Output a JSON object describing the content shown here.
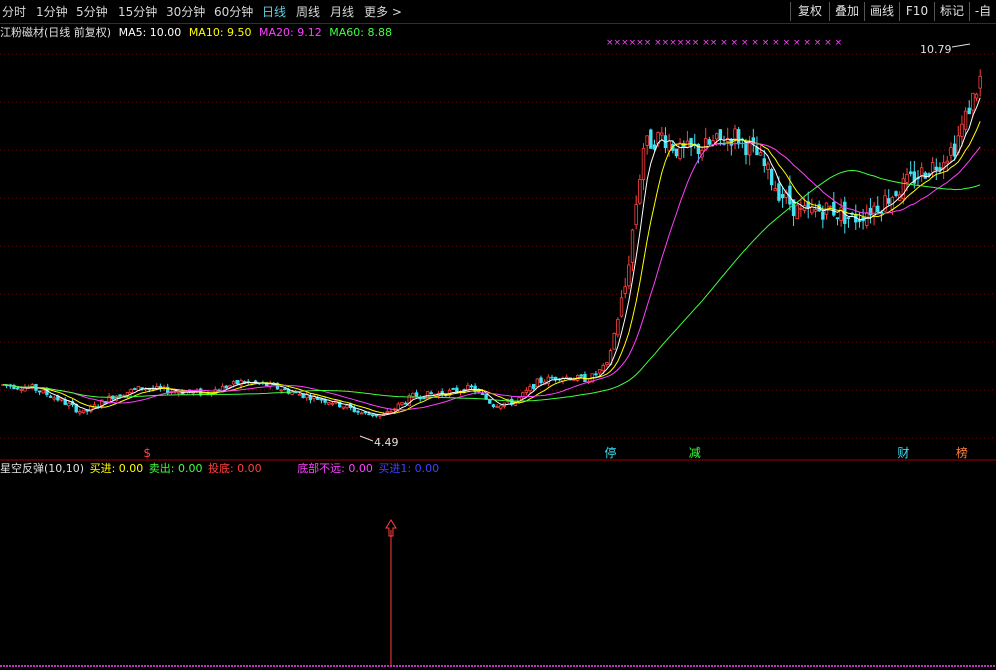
{
  "toolbar": {
    "periods": [
      "分时",
      "1分钟",
      "5分钟",
      "15分钟",
      "30分钟",
      "60分钟",
      "日线",
      "周线",
      "月线"
    ],
    "active_period": "日线",
    "more_label": "更多",
    "more_arrow": ">",
    "buttons": [
      "复权",
      "叠加",
      "画线",
      "F10",
      "标记",
      "-自选"
    ]
  },
  "legend": {
    "stock_title": "江粉磁材(日线 前复权)",
    "ma5_label": "MA5: 10.00",
    "ma10_label": "MA10: 9.50",
    "ma20_label": "MA20: 9.12",
    "ma60_label": "MA60: 8.88"
  },
  "indicator_legend": {
    "name": "星空反弹(10,10)",
    "buy": "买进: 0.00",
    "sell": "卖出: 0.00",
    "bottom": "投底: 0.00",
    "near_bottom": "底部不远: 0.00",
    "buy1": "买进1: 0.00"
  },
  "colors": {
    "up": "#ff4040",
    "down": "#40e0f0",
    "ma5": "#ffffff",
    "ma10": "#ffff00",
    "ma20": "#ff40ff",
    "ma60": "#40ff40",
    "grid": "#8a0000",
    "marker": "#ff40ff",
    "indicator_line": "#ff40ff"
  },
  "chart_data": {
    "type": "candlestick",
    "price_range": [
      3.8,
      11.2
    ],
    "high_label": "10.79",
    "low_label": "4.49",
    "grid": true,
    "top_markers": "×××××× ××××××  ××   ×   × ×   ×    ×     ×   ×    × × × ×  ×",
    "event_labels": [
      {
        "text": "$",
        "color": "#ff4040",
        "bar": 40
      },
      {
        "text": "停",
        "color": "#40e0f0",
        "bar": 166
      },
      {
        "text": "减",
        "color": "#40ff40",
        "bar": 189
      },
      {
        "text": "财",
        "color": "#40e0f0",
        "bar": 246
      },
      {
        "text": "榜",
        "color": "#ff8040",
        "bar": 262
      }
    ],
    "indicator": {
      "buy_arrow_bar": 106,
      "range": [
        0,
        1
      ]
    }
  }
}
